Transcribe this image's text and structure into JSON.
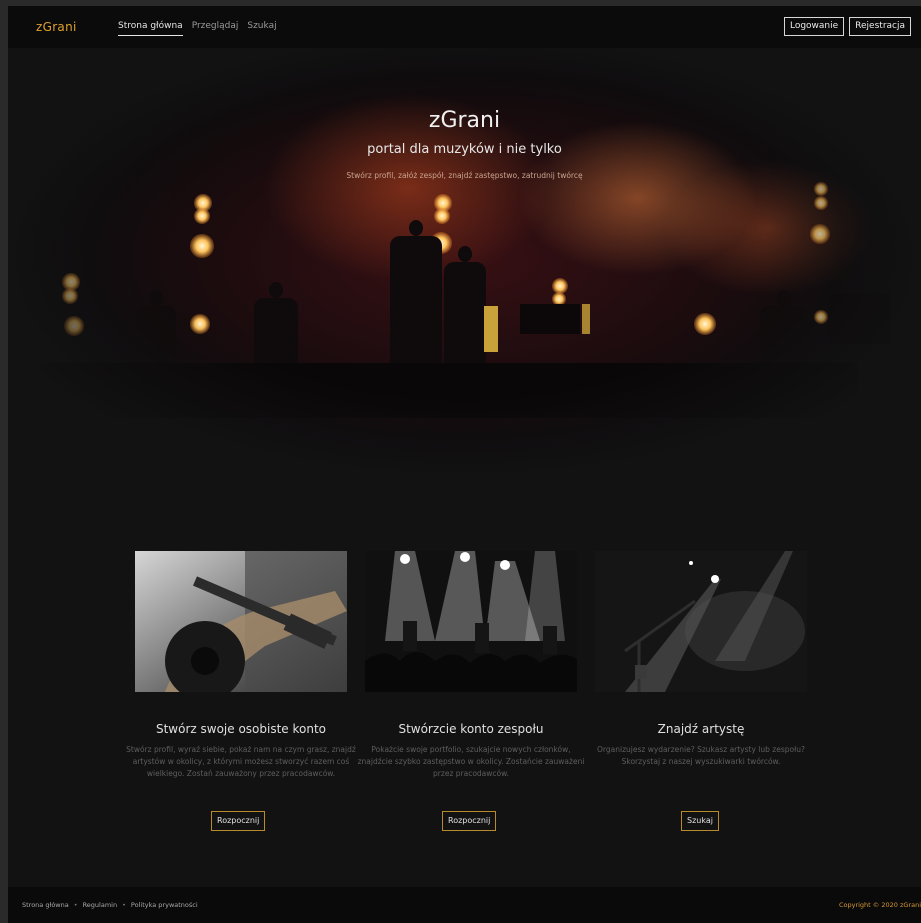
{
  "nav": {
    "brand": "zGrani",
    "links": [
      "Strona główna",
      "Przeglądaj",
      "Szukaj"
    ],
    "login": "Logowanie",
    "register": "Rejestracja"
  },
  "hero": {
    "title": "zGrani",
    "subtitle": "portal dla muzyków i nie tylko",
    "description": "Stwórz profil, załóż zespół, znajdź zastępstwo, zatrudnij twórcę"
  },
  "cards": [
    {
      "title": "Stwórz swoje osobiste konto",
      "text": "Stwórz profil, wyraź siebie, pokaż nam na czym grasz, znajdź artystów w okolicy, z którymi możesz stworzyć razem coś wielkiego. Zostań zauważony przez pracodawców.",
      "button": "Rozpocznij"
    },
    {
      "title": "Stwórzcie konto zespołu",
      "text": "Pokażcie swoje portfolio, szukajcie nowych członków, znajdźcie szybko zastępstwo w okolicy. Zostańcie zauważeni przez pracodawców.",
      "button": "Rozpocznij"
    },
    {
      "title": "Znajdź artystę",
      "text": "Organizujesz wydarzenie? Szukasz artysty lub zespołu? Skorzystaj z naszej wyszukiwarki twórców.",
      "button": "Szukaj"
    }
  ],
  "footer": {
    "links": [
      "Strona główna",
      "Regulamin",
      "Polityka prywatności"
    ],
    "copyright": "Copyright © 2020 zGrani"
  },
  "colors": {
    "accent": "#e0a02c",
    "background": "#121212",
    "button_border": "#b88a2c"
  }
}
